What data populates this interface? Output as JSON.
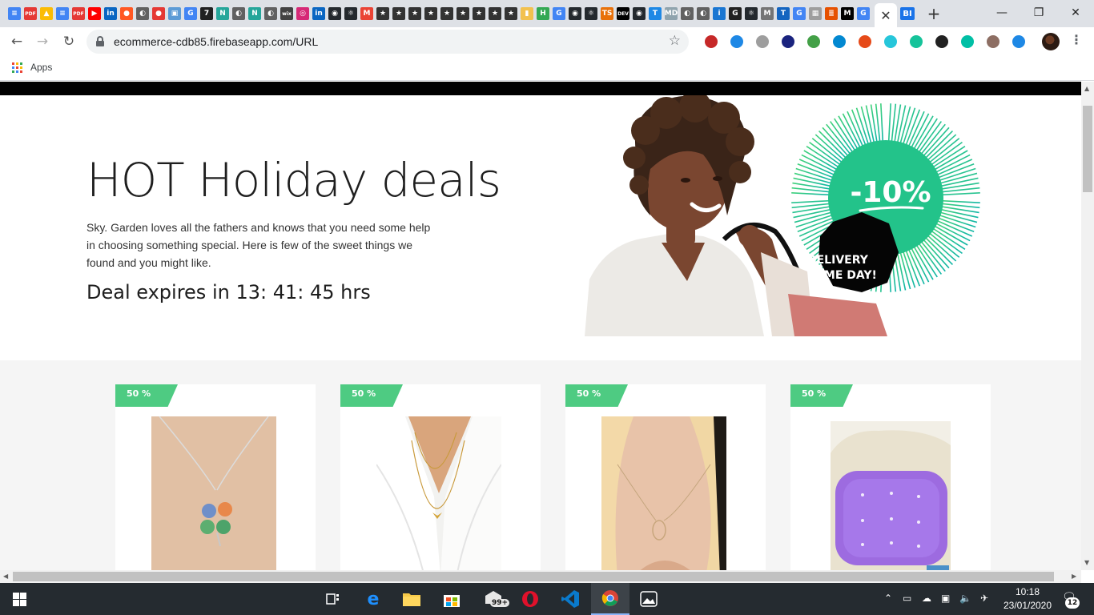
{
  "browser": {
    "tab_close_glyph": "✕",
    "last_tab_label": "BI",
    "new_tab_glyph": "+",
    "window_controls": {
      "minimize": "—",
      "restore": "❐",
      "close": "✕"
    },
    "tab_favicons": [
      {
        "label": "≡",
        "color": "#4285f4"
      },
      {
        "label": "PDF",
        "color": "#e53935"
      },
      {
        "label": "▲",
        "color": "#fbbc04"
      },
      {
        "label": "≡",
        "color": "#4285f4"
      },
      {
        "label": "PDF",
        "color": "#e53935"
      },
      {
        "label": "▶",
        "color": "#ff0000"
      },
      {
        "label": "in",
        "color": "#0a66c2"
      },
      {
        "label": "●",
        "color": "#ff5722"
      },
      {
        "label": "◐",
        "color": "#616161"
      },
      {
        "label": "●",
        "color": "#e53935"
      },
      {
        "label": "▣",
        "color": "#5c9bd6"
      },
      {
        "label": "G",
        "color": "#4285f4"
      },
      {
        "label": "7",
        "color": "#212121"
      },
      {
        "label": "N",
        "color": "#26a69a"
      },
      {
        "label": "◐",
        "color": "#616161"
      },
      {
        "label": "N",
        "color": "#26a69a"
      },
      {
        "label": "◐",
        "color": "#616161"
      },
      {
        "label": "wix",
        "color": "#424242"
      },
      {
        "label": "◎",
        "color": "#d62976"
      },
      {
        "label": "in",
        "color": "#0a66c2"
      },
      {
        "label": "◉",
        "color": "#24292e"
      },
      {
        "label": "⚛",
        "color": "#24292e"
      },
      {
        "label": "M",
        "color": "#ea4335"
      },
      {
        "label": "★",
        "color": "#333333"
      },
      {
        "label": "★",
        "color": "#333333"
      },
      {
        "label": "★",
        "color": "#333333"
      },
      {
        "label": "★",
        "color": "#333333"
      },
      {
        "label": "★",
        "color": "#333333"
      },
      {
        "label": "★",
        "color": "#333333"
      },
      {
        "label": "★",
        "color": "#333333"
      },
      {
        "label": "★",
        "color": "#333333"
      },
      {
        "label": "★",
        "color": "#333333"
      },
      {
        "label": "▮",
        "color": "#f2c14e"
      },
      {
        "label": "H",
        "color": "#34a853"
      },
      {
        "label": "G",
        "color": "#4285f4"
      },
      {
        "label": "◉",
        "color": "#24292e"
      },
      {
        "label": "⚛",
        "color": "#24292e"
      },
      {
        "label": "TS",
        "color": "#e8710a"
      },
      {
        "label": "DEV",
        "color": "#000000"
      },
      {
        "label": "◉",
        "color": "#24292e"
      },
      {
        "label": "T",
        "color": "#1e88e5"
      },
      {
        "label": "MD",
        "color": "#90a4ae"
      },
      {
        "label": "◐",
        "color": "#616161"
      },
      {
        "label": "◐",
        "color": "#616161"
      },
      {
        "label": "i",
        "color": "#1976d2"
      },
      {
        "label": "G",
        "color": "#212121"
      },
      {
        "label": "⚛",
        "color": "#24292e"
      },
      {
        "label": "M",
        "color": "#757575"
      },
      {
        "label": "T",
        "color": "#1565c0"
      },
      {
        "label": "G",
        "color": "#4285f4"
      },
      {
        "label": "▦",
        "color": "#9e9e9e"
      },
      {
        "label": "≣",
        "color": "#e65100"
      },
      {
        "label": "M",
        "color": "#000000"
      },
      {
        "label": "G",
        "color": "#4285f4"
      }
    ],
    "address_bar": {
      "url": "ecommerce-cdb85.firebaseapp.com/URL"
    },
    "extension_colors": [
      "#c62828",
      "#1e88e5",
      "#9e9e9e",
      "#1a237e",
      "#43a047",
      "#0288d1",
      "#e64a19",
      "#26c6da",
      "#15c39a",
      "#212121",
      "#00bfa5",
      "#8d6e63",
      "#1e88e5"
    ],
    "bookmarks": {
      "apps_label": "Apps"
    }
  },
  "page": {
    "hero": {
      "title": "HOT Holiday deals",
      "description": "Sky. Garden loves all the fathers and knows that you need some help in choosing something special. Here is few of the sweet things we found and you might like.",
      "countdown": "Deal expires in 13: 41: 45 hrs",
      "promo_discount": "-10%",
      "promo_delivery_line1": "DELIVERY",
      "promo_delivery_line2": "SAME DAY!"
    },
    "products": [
      {
        "discount": "50 %",
        "image": "clover-necklace"
      },
      {
        "discount": "50 %",
        "image": "gold-layered-necklace"
      },
      {
        "discount": "50 %",
        "image": "circle-pendant-necklace"
      },
      {
        "discount": "50 %",
        "image": "purple-cushion"
      }
    ],
    "accent_green": "#4ecb82",
    "promo_ring_green": "#23c38a"
  },
  "taskbar": {
    "mail_badge": "99+",
    "clock_time": "10:18",
    "clock_date": "23/01/2020",
    "notification_count": "12"
  }
}
